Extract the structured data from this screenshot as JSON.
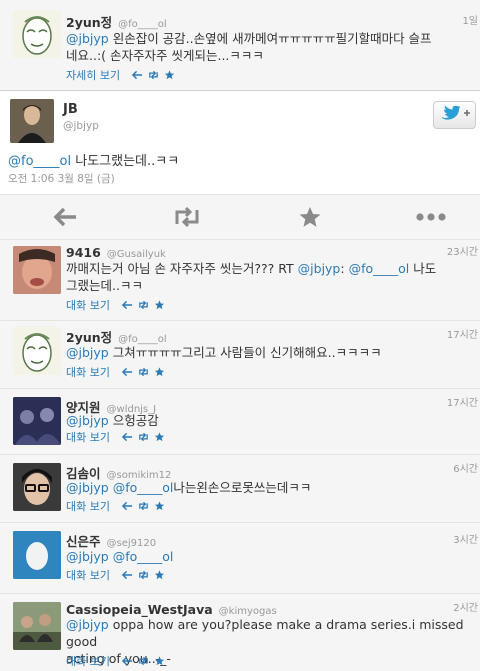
{
  "colors": {
    "link": "#2a7ab8",
    "muted": "#999999",
    "action_icon": "#8a8a8a"
  },
  "top_tweet": {
    "name": "2yun정",
    "handle": "@fo____ol",
    "time": "1일",
    "mention": "@jbjyp",
    "text_line1": " 왼손잡이 공감..손옆에 새까메여ㅠㅠㅠㅠㅠ필기할때마다 슬프",
    "text_line2": "네요..:( 손자주자주 씻게되는...ㅋㅋㅋ",
    "detail_label": "자세히 보기"
  },
  "main_tweet": {
    "name": "JB",
    "handle": "@jbjyp",
    "follow_icon": "twitter-bird-plus-icon",
    "mention": "@fo____ol",
    "text": " 나도그랬는데..ㅋㅋ",
    "timestamp": "오전 1:06 3월 8일 (금)",
    "actions": [
      "reply-icon",
      "retweet-icon",
      "favorite-icon",
      "more-icon"
    ]
  },
  "replies": [
    {
      "name": "9416",
      "handle": "@Gusailyuk",
      "time": "23시간",
      "text_a": "까매지는거 아님 손 자주자주 씻는거??? RT ",
      "m1": "@jbjyp",
      "text_b": ": ",
      "m2": "@fo____ol",
      "text_c": " 나도",
      "text_line2": "그랬는데..ㅋㅋ",
      "action_label": "대화 보기"
    },
    {
      "name": "2yun정",
      "handle": "@fo____ol",
      "time": "17시간",
      "m1": "@jbjyp",
      "text_a": " 그쳐ㅠㅠㅠㅠ그리고 사람들이 신기해해요..ㅋㅋㅋㅋ",
      "action_label": "대화 보기"
    },
    {
      "name": "양지원",
      "handle": "@wldnjs_J",
      "time": "17시간",
      "m1": "@jbjyp",
      "text_a": " 으헝공감",
      "action_label": "대화 보기"
    },
    {
      "name": "김솜이",
      "handle": "@somikim12",
      "time": "6시간",
      "m1": "@jbjyp",
      "m2": "@fo____ol",
      "text_a": "나는왼손으로못쓰는데ㅋㅋ",
      "action_label": "대화 보기"
    },
    {
      "name": "신은주",
      "handle": "@sej9120",
      "time": "3시간",
      "m1": "@jbjyp",
      "m2": "@fo____ol",
      "action_label": "대화 보기"
    },
    {
      "name": "Cassiopeia_WestJava",
      "handle": "@kimyogas",
      "time": "2시간",
      "m1": "@jbjyp",
      "text_a": " oppa how are you?please make a drama series.i missed good",
      "text_line2": "acting of you..-_-",
      "action_label": "대화 보기"
    }
  ]
}
